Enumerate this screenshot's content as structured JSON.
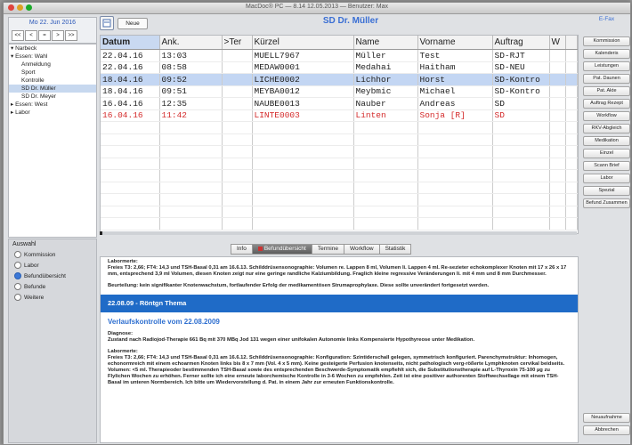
{
  "window": {
    "title": "MacDoc® PC — 8.14   12.05.2013 — Benutzer: Max"
  },
  "calendar": {
    "date": "Mo 22. Jun 2016",
    "nav": [
      "<<",
      "<",
      "=",
      ">",
      ">>"
    ]
  },
  "tree": [
    {
      "label": "▾ Narbeck",
      "sel": false,
      "indent": 0
    },
    {
      "label": "▾ Essen: Wahl",
      "sel": false,
      "indent": 0
    },
    {
      "label": "Anmeldung",
      "sel": false,
      "indent": 2
    },
    {
      "label": "Sport",
      "sel": false,
      "indent": 2
    },
    {
      "label": "Kontrolle",
      "sel": false,
      "indent": 2
    },
    {
      "label": "SD Dr. Müller",
      "sel": true,
      "indent": 2
    },
    {
      "label": "SD Dr. Meyer",
      "sel": false,
      "indent": 2
    },
    {
      "label": "▸ Essen: West",
      "sel": false,
      "indent": 0
    },
    {
      "label": "▸ Labor",
      "sel": false,
      "indent": 0
    }
  ],
  "auswahl": {
    "title": "Auswahl",
    "options": [
      {
        "label": "Kommission",
        "on": false
      },
      {
        "label": "Labor",
        "on": false
      },
      {
        "label": "Befundübersicht",
        "on": true
      },
      {
        "label": "Befunde",
        "on": false
      },
      {
        "label": "Weitere",
        "on": false
      }
    ]
  },
  "toolbar": {
    "view_label": "Neue"
  },
  "patient_header": "SD Dr. Müller",
  "table": {
    "headers": [
      "Datum",
      "Ank.",
      ">Ter",
      "Kürzel",
      "Name",
      "Vorname",
      "Auftrag",
      "W"
    ],
    "rows": [
      {
        "cells": [
          "22.04.16",
          "13:03",
          "",
          "MUELL7967",
          "Müller",
          "Test",
          "SD-RJT",
          ""
        ],
        "sel": false,
        "red": false
      },
      {
        "cells": [
          "22.04.16",
          "08:58",
          "",
          "MEDAW0001",
          "Medahai",
          "Haitham",
          "SD-NEU",
          ""
        ],
        "sel": false,
        "red": false
      },
      {
        "cells": [
          "18.04.16",
          "09:52",
          "",
          "LICHE0002",
          "Lichhor",
          "Horst",
          "SD-Kontro",
          ""
        ],
        "sel": true,
        "red": false
      },
      {
        "cells": [
          "18.04.16",
          "09:51",
          "",
          "MEYBA0012",
          "Meybmic",
          "Michael",
          "SD-Kontro",
          ""
        ],
        "sel": false,
        "red": false
      },
      {
        "cells": [
          "16.04.16",
          "12:35",
          "",
          "NAUBE0013",
          "Nauber",
          "Andreas",
          "SD",
          ""
        ],
        "sel": false,
        "red": false
      },
      {
        "cells": [
          "16.04.16",
          "11:42",
          "",
          "LINTE0003",
          "Linten",
          "Sonja [R]",
          "SD",
          ""
        ],
        "sel": false,
        "red": true
      }
    ]
  },
  "right_panel": {
    "top": "E-Fax",
    "buttons": [
      "Kommission",
      "Kalenderis",
      "Leistungen",
      "Pat. Daunen",
      "Pat. Akte",
      "Auftrag Rezept",
      "Workflow",
      "RKV-Abgleich",
      "Medikation",
      "Einzel",
      "Scann Brief",
      "Labor",
      "Spezial",
      "Befund Zusammen"
    ],
    "bottom": [
      "Neuaufnahme",
      "Abbrechen"
    ]
  },
  "tabs": [
    "Info",
    "Befundübersicht",
    "Termine",
    "Workflow",
    "Statistik"
  ],
  "document": {
    "p1_label": "Labormerte:",
    "p1": "Freies T3: 2,66; FT4: 14,3 und TSH-Basal 0,31 am 16.6.13. Schilddrüsensonographie: Volumen re. Lappen 8 ml, Volumen li. Lappen 4 ml. Re-sezieter echokomplexer Knoten mit 17 x 26 x 17 mm, entsprechend 3,9 ml Volumen, diesen Knoten zeigt nur eine geringe randliche Kalziumbildung. Fraglich kleine regressive Veränderungen li. mit 4 mm und 8 mm Durchmesser.",
    "p2": "Beurteilung: kein signifikanter Knotenwachstum, fortlaufender Erfolg der medikamentösen Strumaprophylaxe. Diese sollte unverändert fortgesetzt werden.",
    "banner": "22.08.09 - Röntgn Thema",
    "visit_title": "Verlaufskontrolle vom 22.08.2009",
    "diag_label": "Diagnose:",
    "diag": "Zustand nach Radiojod-Therapie 661 Bq mit 370 MBq Jod 131 wegen einer unifokalen Autonomie links Kompensierte Hypothyreose unter Medikation.",
    "lab2_label": "Labormerte:",
    "lab2": "Freies T3: 2,66; FT4: 14,3 und TSH-Basal 0,31 am 16.6.12. Schilddrüsensonographie: Konfiguration: Szintiderschall gelegen, symmetrisch konfiguriert. Parenchymstruktur: Inhomogen, echonormreich mit einem echoarmen Knoten links bis 8 x 7 mm (Vol. 4 x 5 mm). Keine gesteigerte Perfusion knotenseits, nicht pathologisch verg-rößerte Lymphknoten cervikal beidseits. Volumen: <5 ml. Therapieoder bestimmenden TSH-Basal sowie des entsprechenden Beschwerde-Symptomatik empfiehlt sich, die Substitutionstherapie auf L-Thyroxin 75-100 µg zu Flylichen Wochen zu erhöhen. Ferner sollte ich eine erneute laborchemische Kontrolle in 3-6 Wochen zu empfehlen. Zeit ist eine positiver authorenten Stoffwechsellage mit einem TSH-Basal im unteren Normbereich. Ich bitte um Wiedervorstellung d. Pat. in einem Jahr zur erneuten Funktionskontrolle."
  }
}
